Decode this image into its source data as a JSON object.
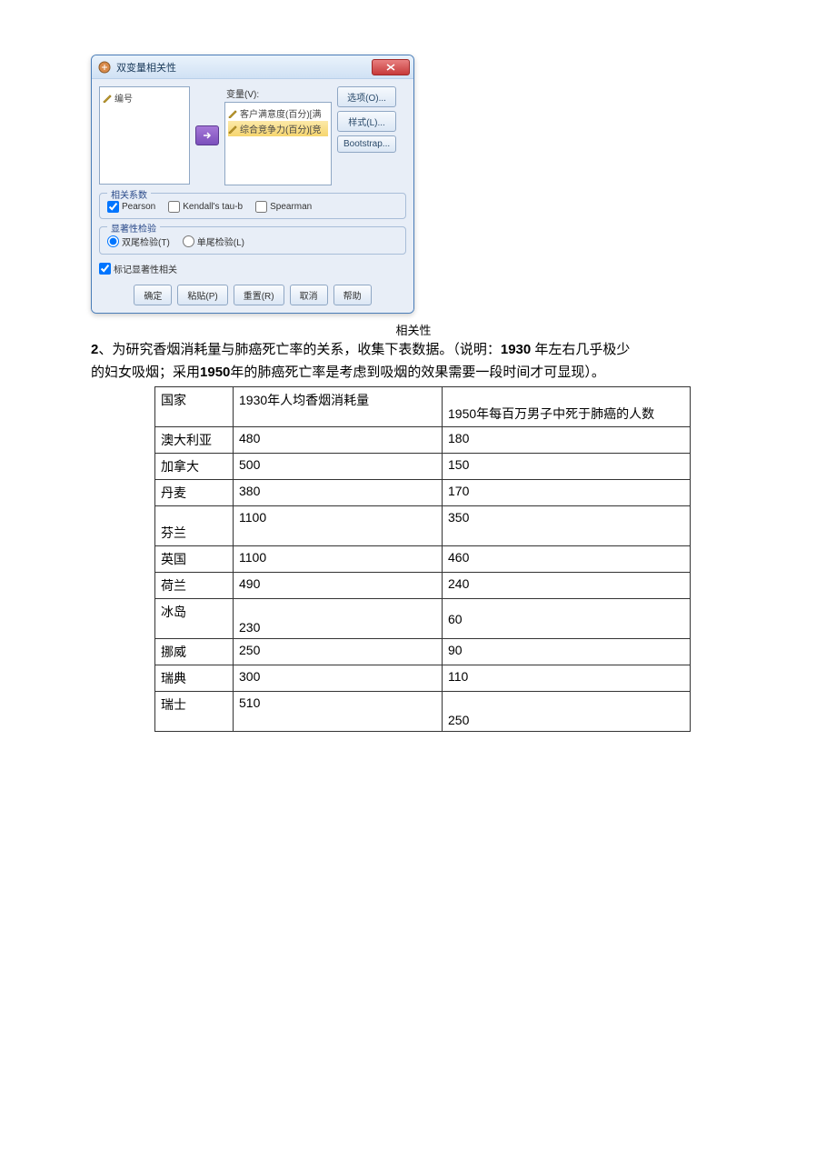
{
  "dialog": {
    "title": "双变量相关性",
    "leftList": [
      "编号"
    ],
    "varLabel": "变量(V):",
    "rightList": [
      "客户满意度(百分)[满",
      "综合竞争力(百分)[竞"
    ],
    "sideButtons": [
      "选项(O)...",
      "样式(L)...",
      "Bootstrap..."
    ],
    "group1": {
      "title": "相关系数",
      "options": [
        "Pearson",
        "Kendall's tau-b",
        "Spearman"
      ]
    },
    "group2": {
      "title": "显著性检验",
      "options": [
        "双尾检验(T)",
        "单尾检验(L)"
      ]
    },
    "flag": "标记显著性相关",
    "buttons": [
      "确定",
      "粘贴(P)",
      "重置(R)",
      "取消",
      "帮助"
    ]
  },
  "caption": "相关性",
  "question": {
    "prefix": "2",
    "line1a": "、为研究香烟消耗量与肺癌死亡率的关系，收集下表数据。（说明：",
    "line1b": "1930",
    "line1c": " 年左右几乎极少",
    "line2a": "的妇女吸烟；采用",
    "line2b": "1950",
    "line2c": "年的肺癌死亡率是考虑到吸烟的效果需要一段时间才可显现）。"
  },
  "tableHeaders": [
    "国家",
    "1930年人均香烟消耗量",
    "1950年每百万男子中死于肺癌的人数"
  ],
  "tableRows": [
    {
      "country": "澳大利亚",
      "consumption": "480",
      "deaths": "180"
    },
    {
      "country": "加拿大",
      "consumption": "500",
      "deaths": "150"
    },
    {
      "country": "丹麦",
      "consumption": "380",
      "deaths": "170"
    },
    {
      "country": "芬兰",
      "consumption": "1100",
      "deaths": "350"
    },
    {
      "country": "英国",
      "consumption": "1100",
      "deaths": "460"
    },
    {
      "country": "荷兰",
      "consumption": "490",
      "deaths": "240"
    },
    {
      "country": "冰岛",
      "consumption": "230",
      "deaths": "60"
    },
    {
      "country": "挪威",
      "consumption": "250",
      "deaths": "90"
    },
    {
      "country": "瑞典",
      "consumption": "300",
      "deaths": "110"
    },
    {
      "country": "瑞士",
      "consumption": "510",
      "deaths": "250"
    }
  ]
}
